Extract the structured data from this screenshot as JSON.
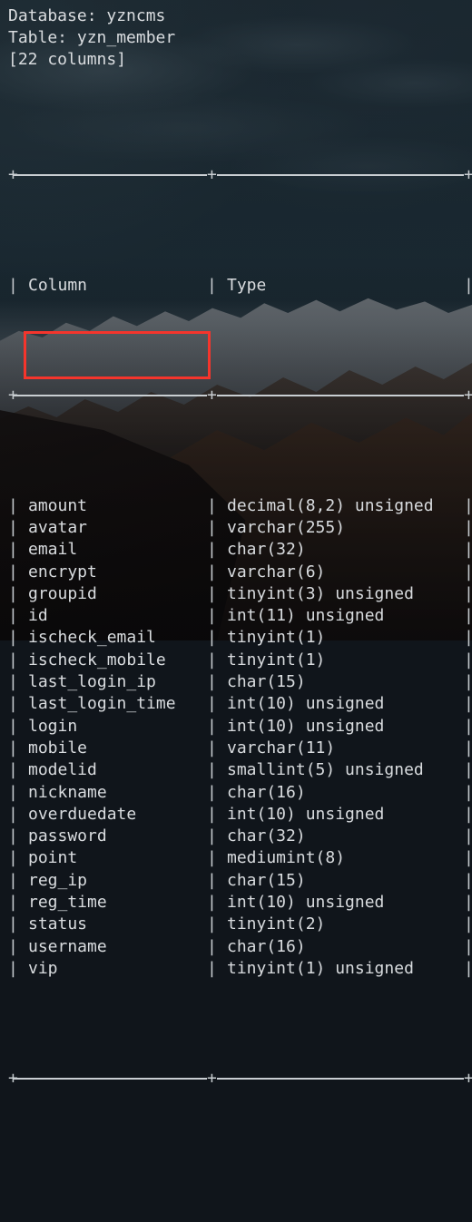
{
  "header": {
    "database_line": "Database: yzncms",
    "table_line": "Table: yzn_member",
    "count_line": "[22 columns]"
  },
  "table": {
    "columns": [
      "Column",
      "Type"
    ],
    "rows": [
      {
        "column": "amount",
        "type": "decimal(8,2) unsigned"
      },
      {
        "column": "avatar",
        "type": "varchar(255)"
      },
      {
        "column": "email",
        "type": "char(32)"
      },
      {
        "column": "encrypt",
        "type": "varchar(6)"
      },
      {
        "column": "groupid",
        "type": "tinyint(3) unsigned"
      },
      {
        "column": "id",
        "type": "int(11) unsigned"
      },
      {
        "column": "ischeck_email",
        "type": "tinyint(1)"
      },
      {
        "column": "ischeck_mobile",
        "type": "tinyint(1)"
      },
      {
        "column": "last_login_ip",
        "type": "char(15)"
      },
      {
        "column": "last_login_time",
        "type": "int(10) unsigned"
      },
      {
        "column": "login",
        "type": "int(10) unsigned"
      },
      {
        "column": "mobile",
        "type": "varchar(11)"
      },
      {
        "column": "modelid",
        "type": "smallint(5) unsigned"
      },
      {
        "column": "nickname",
        "type": "char(16)"
      },
      {
        "column": "overduedate",
        "type": "int(10) unsigned"
      },
      {
        "column": "password",
        "type": "char(32)"
      },
      {
        "column": "point",
        "type": "mediumint(8)"
      },
      {
        "column": "reg_ip",
        "type": "char(15)"
      },
      {
        "column": "reg_time",
        "type": "int(10) unsigned"
      },
      {
        "column": "status",
        "type": "tinyint(2)"
      },
      {
        "column": "username",
        "type": "char(16)"
      },
      {
        "column": "vip",
        "type": "tinyint(1) unsigned"
      }
    ]
  },
  "glyphs": {
    "vertical_bar": "|",
    "plus": "+"
  },
  "annotation": {
    "highlight_color": "#f5352c",
    "highlighted_rows": [
      "last_login_time",
      "login"
    ]
  },
  "colors": {
    "text": "#d9dcdf",
    "rule": "#c9ced2",
    "backdrop": "#1e2f39"
  }
}
